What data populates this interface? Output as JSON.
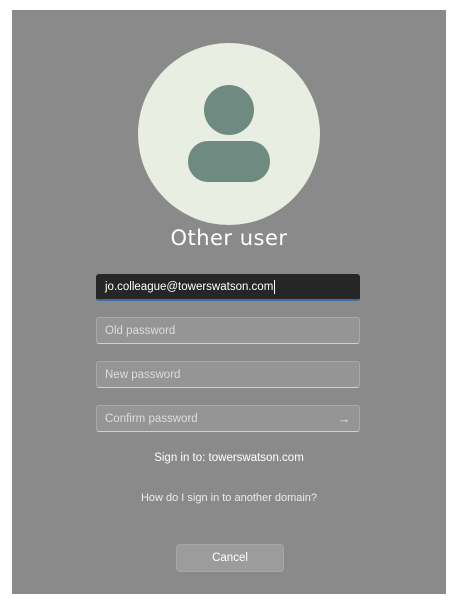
{
  "login": {
    "user_title": "Other user",
    "username_value": "jo.colleague@towerswatson.com",
    "old_password_placeholder": "Old password",
    "new_password_placeholder": "New password",
    "confirm_password_placeholder": "Confirm password",
    "submit_icon": "arrow-right-icon",
    "sign_in_to": "Sign in to: towerswatson.com",
    "other_domain_link": "How do I sign in to another domain?",
    "cancel_label": "Cancel",
    "avatar_icon": "user-silhouette-icon"
  },
  "colors": {
    "background": "#8a8a8a",
    "avatar_circle": "#e9eee3",
    "avatar_figure": "#6f8a80",
    "active_field": "#262626",
    "focus_underline": "#3e6ea8"
  }
}
